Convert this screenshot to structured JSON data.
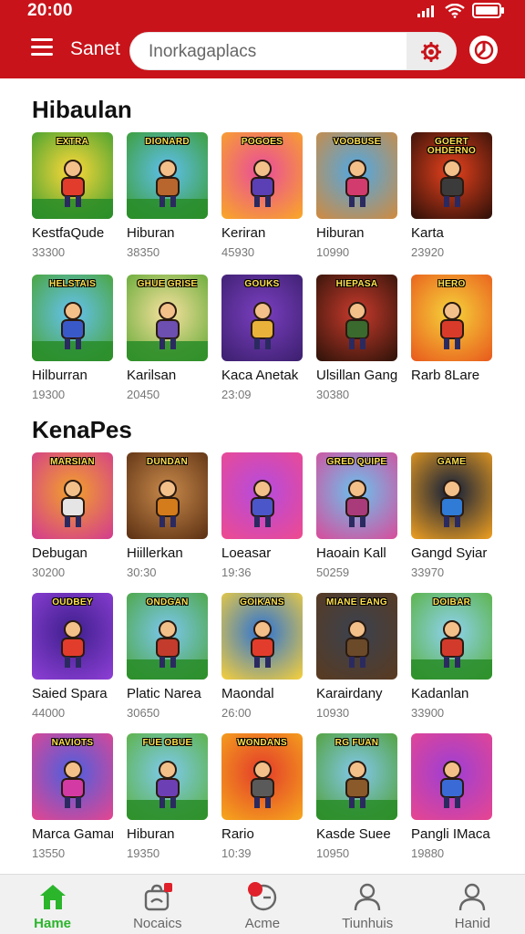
{
  "status": {
    "time": "20:00"
  },
  "header": {
    "app_title": "Sanet",
    "search_placeholder": "Inorkagaplacs"
  },
  "sections": [
    {
      "title": "Hibaulan",
      "games": [
        {
          "name": "KestfaQude",
          "count": "33300",
          "logo": "EXTRA",
          "c1": "#ffd93a",
          "c2": "#3b9e2f",
          "shirt": "#e23c2c",
          "ground": true
        },
        {
          "name": "Hiburan",
          "count": "38350",
          "logo": "DIONARD",
          "c1": "#5fc0f0",
          "c2": "#3a9b2b",
          "shirt": "#b8662d",
          "ground": true
        },
        {
          "name": "Keriran",
          "count": "45930",
          "logo": "POGOES",
          "c1": "#e94b9c",
          "c2": "#f9a825",
          "shirt": "#5b3fb4",
          "ground": false
        },
        {
          "name": "Hiburan",
          "count": "10990",
          "logo": "VOOBUSE",
          "c1": "#4da9e8",
          "c2": "#d28a3c",
          "shirt": "#d23b6d",
          "ground": false
        },
        {
          "name": "Karta",
          "count": "23920",
          "logo": "GOERT OHDERNO",
          "c1": "#e8421d",
          "c2": "#2b0f08",
          "shirt": "#3b3b3b",
          "ground": false
        },
        {
          "name": "Hilburran",
          "count": "19300",
          "logo": "HELSTAIS",
          "c1": "#65c2f2",
          "c2": "#48a32f",
          "shirt": "#3a59c9",
          "ground": true
        },
        {
          "name": "Karilsan",
          "count": "20450",
          "logo": "GHUE GRISE",
          "c1": "#f9e2a0",
          "c2": "#5fa833",
          "shirt": "#6c4fb0",
          "ground": true
        },
        {
          "name": "Kaca Anetak",
          "count": "23:09",
          "logo": "GOUKS",
          "c1": "#7b3fc1",
          "c2": "#3b1f6d",
          "shirt": "#e9b23a",
          "ground": false
        },
        {
          "name": "Ulsillan Gang",
          "count": "30380",
          "logo": "HIEPASA",
          "c1": "#c93b2d",
          "c2": "#2c1208",
          "shirt": "#3a6a2e",
          "ground": false
        },
        {
          "name": "Rarb 8Lare",
          "count": "",
          "logo": "HERO",
          "c1": "#f6d43a",
          "c2": "#e8581c",
          "shirt": "#d93b2b",
          "ground": false
        }
      ]
    },
    {
      "title": "KenaPes",
      "games": [
        {
          "name": "Debugan",
          "count": "30200",
          "logo": "MARSIAN",
          "c1": "#f2a22a",
          "c2": "#d33a8f",
          "shirt": "#e5e5e5",
          "ground": false
        },
        {
          "name": "Hiillerkan",
          "count": "30:30",
          "logo": "DUNDAN",
          "c1": "#c98a4b",
          "c2": "#5a2f12",
          "shirt": "#d47b1b",
          "ground": false
        },
        {
          "name": "Loeasar",
          "count": "19:36",
          "logo": "",
          "c1": "#b34be0",
          "c2": "#ef4a8e",
          "shirt": "#4b56c9",
          "ground": false
        },
        {
          "name": "Haoain Kall",
          "count": "50259",
          "logo": "GRED QUIPE",
          "c1": "#69c3ef",
          "c2": "#d94b9a",
          "shirt": "#a93b7b",
          "ground": false
        },
        {
          "name": "Gangd Syiar",
          "count": "33970",
          "logo": "GAME",
          "c1": "#0d1c3a",
          "c2": "#f0a020",
          "shirt": "#2f7bd6",
          "ground": false
        },
        {
          "name": "Saied Spara",
          "count": "44000",
          "logo": "OUDBEY",
          "c1": "#3d1f8c",
          "c2": "#8e3fd6",
          "shirt": "#e23c2c",
          "ground": false
        },
        {
          "name": "Platic Narea",
          "count": "30650",
          "logo": "ONDGAN",
          "c1": "#7cc7f0",
          "c2": "#4aa53a",
          "shirt": "#c23b2c",
          "ground": true
        },
        {
          "name": "Maondal",
          "count": "26:00",
          "logo": "GOIKANS",
          "c1": "#2a72d6",
          "c2": "#f7d03a",
          "shirt": "#e23c2c",
          "ground": false
        },
        {
          "name": "Karairdany",
          "count": "10930",
          "logo": "MIANE EANG",
          "c1": "#3a4250",
          "c2": "#5a3a1f",
          "shirt": "#6b4a2a",
          "ground": false
        },
        {
          "name": "Kadanlan",
          "count": "33900",
          "logo": "DOIBAR",
          "c1": "#8fd2f2",
          "c2": "#57b13a",
          "shirt": "#d23b2b",
          "ground": true
        },
        {
          "name": "Marca Gaman",
          "count": "13550",
          "logo": "NAVIOTS",
          "c1": "#4a5fe0",
          "c2": "#e6458f",
          "shirt": "#d43aa3",
          "ground": false
        },
        {
          "name": "Hiburan",
          "count": "19350",
          "logo": "FUE OBUE",
          "c1": "#7fcaf0",
          "c2": "#5ab13a",
          "shirt": "#6d3fb4",
          "ground": true
        },
        {
          "name": "Rario",
          "count": "10:39",
          "logo": "WONDANS",
          "c1": "#e33a2a",
          "c2": "#f6a81c",
          "shirt": "#5a5a5a",
          "ground": false
        },
        {
          "name": "Kasde Suee",
          "count": "10950",
          "logo": "RG FUAN",
          "c1": "#83c8ef",
          "c2": "#4f9f2f",
          "shirt": "#8a5a2a",
          "ground": true
        },
        {
          "name": "Pangli IMaca",
          "count": "19880",
          "logo": "",
          "c1": "#9b3fd6",
          "c2": "#e8458f",
          "shirt": "#3a6ad6",
          "ground": false
        }
      ]
    }
  ],
  "bottom_nav": [
    {
      "label": "Hame",
      "icon": "home-icon",
      "active": true
    },
    {
      "label": "Nocaics",
      "icon": "bag-icon",
      "active": false
    },
    {
      "label": "Acme",
      "icon": "clock-icon",
      "active": false
    },
    {
      "label": "Tiunhuis",
      "icon": "user-icon",
      "active": false
    },
    {
      "label": "Hanid",
      "icon": "user-icon",
      "active": false
    }
  ],
  "colors": {
    "brand": "#c8131a",
    "active_nav": "#2bb52b",
    "badge": "#e0202a"
  }
}
